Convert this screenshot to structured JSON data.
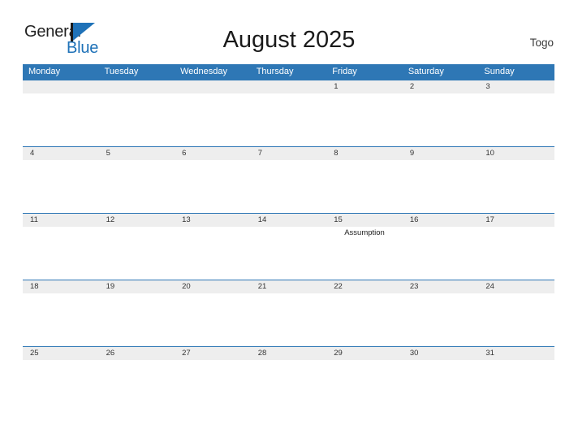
{
  "brand": {
    "word_one": "General",
    "word_two": "Blue",
    "flag_icon": "blue-flag-triangle",
    "accent_color": "#1f72b8"
  },
  "header": {
    "title": "August 2025",
    "country": "Togo"
  },
  "colors": {
    "header_blue": "#2e77b5",
    "date_band_gray": "#eeeeee",
    "text_dark": "#333333"
  },
  "calendar": {
    "weekdays": [
      "Monday",
      "Tuesday",
      "Wednesday",
      "Thursday",
      "Friday",
      "Saturday",
      "Sunday"
    ],
    "weeks": [
      {
        "days": [
          {
            "num": "",
            "event": ""
          },
          {
            "num": "",
            "event": ""
          },
          {
            "num": "",
            "event": ""
          },
          {
            "num": "",
            "event": ""
          },
          {
            "num": "1",
            "event": ""
          },
          {
            "num": "2",
            "event": ""
          },
          {
            "num": "3",
            "event": ""
          }
        ]
      },
      {
        "days": [
          {
            "num": "4",
            "event": ""
          },
          {
            "num": "5",
            "event": ""
          },
          {
            "num": "6",
            "event": ""
          },
          {
            "num": "7",
            "event": ""
          },
          {
            "num": "8",
            "event": ""
          },
          {
            "num": "9",
            "event": ""
          },
          {
            "num": "10",
            "event": ""
          }
        ]
      },
      {
        "days": [
          {
            "num": "11",
            "event": ""
          },
          {
            "num": "12",
            "event": ""
          },
          {
            "num": "13",
            "event": ""
          },
          {
            "num": "14",
            "event": ""
          },
          {
            "num": "15",
            "event": "Assumption"
          },
          {
            "num": "16",
            "event": ""
          },
          {
            "num": "17",
            "event": ""
          }
        ]
      },
      {
        "days": [
          {
            "num": "18",
            "event": ""
          },
          {
            "num": "19",
            "event": ""
          },
          {
            "num": "20",
            "event": ""
          },
          {
            "num": "21",
            "event": ""
          },
          {
            "num": "22",
            "event": ""
          },
          {
            "num": "23",
            "event": ""
          },
          {
            "num": "24",
            "event": ""
          }
        ]
      },
      {
        "days": [
          {
            "num": "25",
            "event": ""
          },
          {
            "num": "26",
            "event": ""
          },
          {
            "num": "27",
            "event": ""
          },
          {
            "num": "28",
            "event": ""
          },
          {
            "num": "29",
            "event": ""
          },
          {
            "num": "30",
            "event": ""
          },
          {
            "num": "31",
            "event": ""
          }
        ]
      }
    ]
  }
}
